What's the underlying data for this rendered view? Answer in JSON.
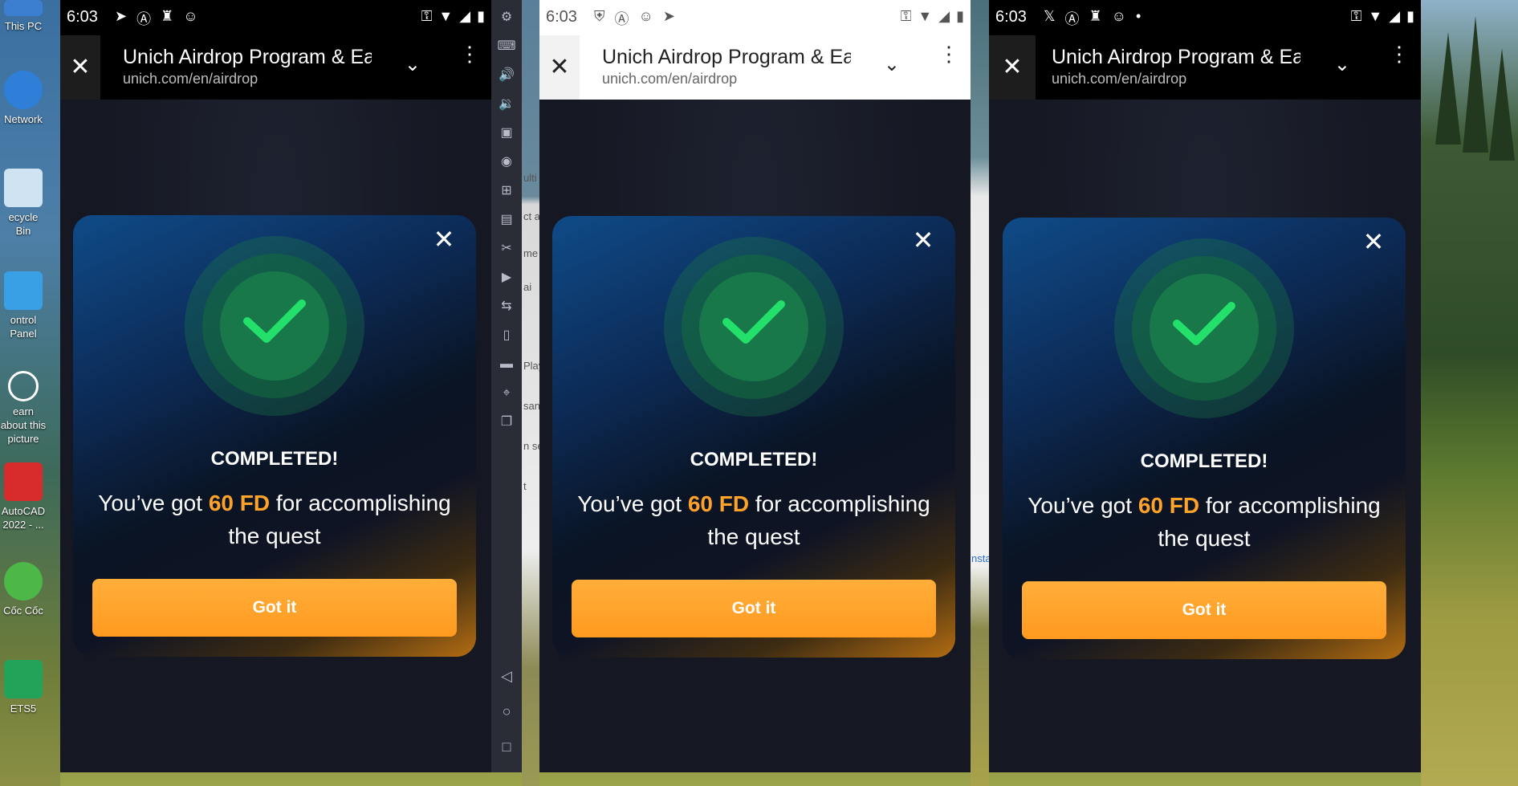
{
  "desktop": {
    "icons": [
      {
        "label": "This PC"
      },
      {
        "label": "Network"
      },
      {
        "label": "ecycle Bin"
      },
      {
        "label": "ontrol Panel"
      },
      {
        "label": "earn about this picture"
      },
      {
        "label": "AutoCAD 2022 - ..."
      },
      {
        "label": "Cốc Cốc"
      },
      {
        "label": "ETS5"
      }
    ]
  },
  "phones": [
    {
      "status": {
        "time": "6:03"
      },
      "toolbar": {
        "title": "Unich Airdrop Program & Ea",
        "url": "unich.com/en/airdrop"
      },
      "modal": {
        "heading": "COMPLETED!",
        "msg_prefix": "You’ve got ",
        "amount": "60 FD",
        "msg_suffix": " for accomplishing the quest",
        "button": "Got it"
      }
    },
    {
      "status": {
        "time": "6:03"
      },
      "toolbar": {
        "title": "Unich Airdrop Program & Ea",
        "url": "unich.com/en/airdrop"
      },
      "modal": {
        "heading": "COMPLETED!",
        "msg_prefix": "You’ve got ",
        "amount": "60 FD",
        "msg_suffix": " for accomplishing the quest",
        "button": "Got it"
      }
    },
    {
      "status": {
        "time": "6:03"
      },
      "toolbar": {
        "title": "Unich Airdrop Program & Ea",
        "url": "unich.com/en/airdrop"
      },
      "modal": {
        "heading": "COMPLETED!",
        "msg_prefix": "You’ve got ",
        "amount": "60 FD",
        "msg_suffix": " for accomplishing the quest",
        "button": "Got it"
      }
    }
  ],
  "background_peek": {
    "items": [
      "ulti",
      "ct a",
      "me",
      "ai",
      "Play",
      "san",
      "n se",
      "t",
      "nsta"
    ]
  },
  "colors": {
    "accent": "#ffa229",
    "button": "#ff9a1f",
    "badge": "#18784a",
    "check": "#22e06a"
  }
}
